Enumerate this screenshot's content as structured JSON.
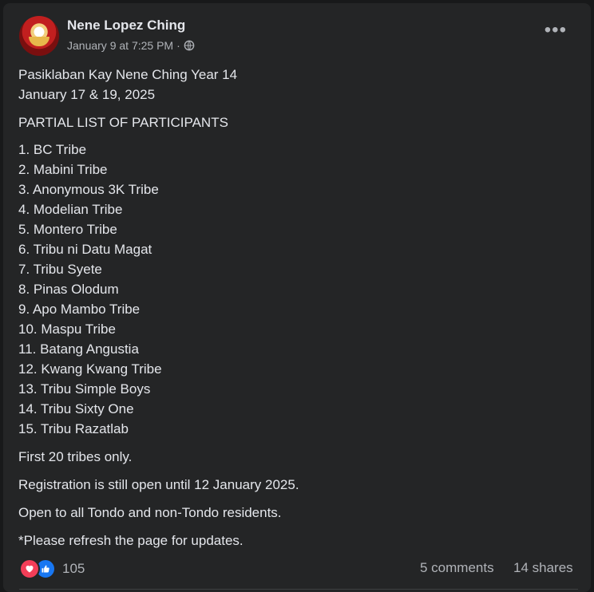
{
  "post": {
    "author": "Nene Lopez Ching",
    "meta_time": "January 9 at 7:25 PM",
    "meta_sep": "·",
    "title_line1": "Pasiklaban Kay Nene Ching Year 14",
    "title_line2": "January 17 & 19, 2025",
    "section_heading": "PARTIAL LIST OF PARTICIPANTS",
    "participants": [
      "1. BC Tribe",
      "2. Mabini Tribe",
      "3. Anonymous 3K Tribe",
      "4. Modelian Tribe",
      "5. Montero Tribe",
      "6. Tribu ni Datu Magat",
      "7. Tribu Syete",
      "8. Pinas Olodum",
      "9. Apo Mambo Tribe",
      "10. Maspu Tribe",
      "11. Batang Angustia",
      "12. Kwang Kwang Tribe",
      "13. Tribu Simple Boys",
      "14. Tribu Sixty One",
      "15. Tribu Razatlab"
    ],
    "note1": "First 20 tribes only.",
    "note2": "Registration is still open until 12 January 2025.",
    "note3": "Open to all Tondo and non-Tondo residents.",
    "note4": "*Please refresh the page for updates."
  },
  "footer": {
    "reaction_count": "105",
    "comments": "5 comments",
    "shares": "14 shares"
  },
  "icons": {
    "avatar": "profile-photo",
    "globe": "globe-icon",
    "more": "more-options-icon",
    "love": "love-react-icon",
    "like": "like-react-icon"
  },
  "colors": {
    "post_bg": "#242526",
    "text": "#e4e6eb",
    "muted": "#b0b3b8",
    "love": "#f33e58",
    "like": "#1877f2"
  }
}
